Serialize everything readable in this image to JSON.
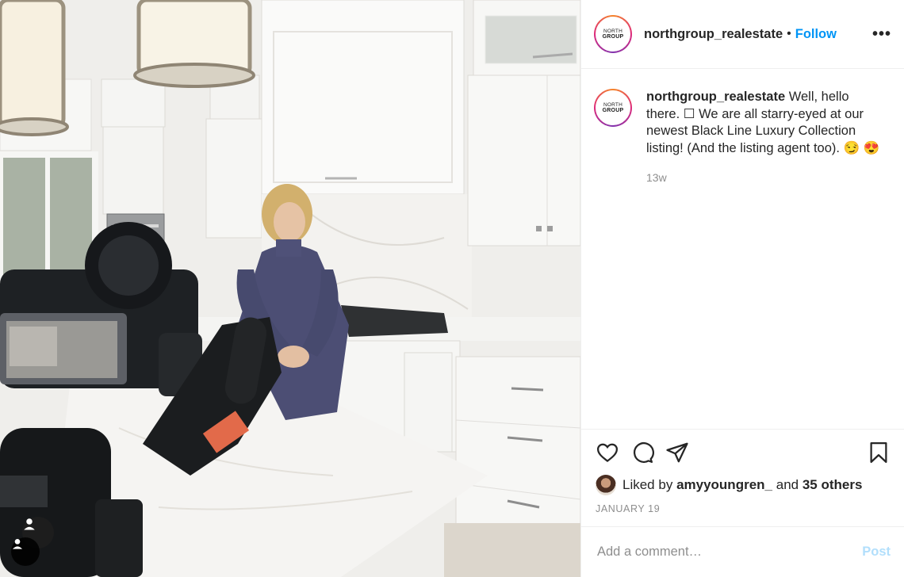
{
  "post": {
    "username": "northgroup_realestate",
    "follow_label": "Follow",
    "separator": "•",
    "more_label": "•••",
    "avatar_logo_top": "NORTH",
    "avatar_logo_bottom": "GROUP",
    "caption": "Well, hello there. ☐ We are all starry-eyed at our newest Black Line Luxury Collection listing! (And the listing agent too). 😏 😍",
    "time_ago": "13w",
    "likes_prefix": "Liked by",
    "liked_by_user": "amyyoungren_",
    "likes_and": "and",
    "likes_others": "35 others",
    "date": "JANUARY 19"
  },
  "actions": {
    "like_icon": "heart-icon",
    "comment_icon": "comment-icon",
    "share_icon": "send-icon",
    "save_icon": "bookmark-icon"
  },
  "comment": {
    "placeholder": "Add a comment…",
    "post_label": "Post"
  },
  "colors": {
    "accent": "#0095f6",
    "post_disabled": "#b2dffc",
    "muted": "#8e8e8e",
    "text": "#262626"
  }
}
